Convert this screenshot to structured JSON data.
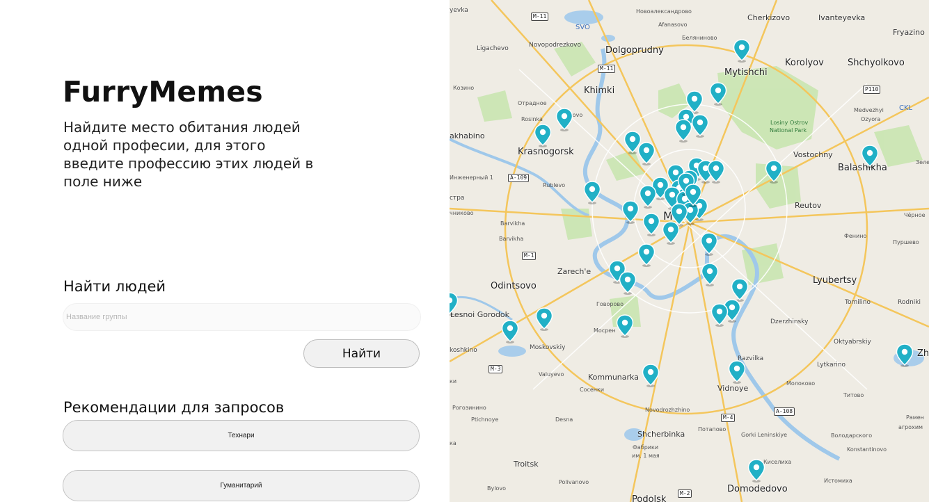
{
  "app": {
    "title": "FurryMemes",
    "description": "Найдите место обитания людей одной професии, для этого введите профессию этих людей в поле ниже"
  },
  "search": {
    "heading": "Найти людей",
    "placeholder": "Название группы",
    "value": "",
    "button_label": "Найти"
  },
  "recommendations": {
    "heading": "Рекомендации для запросов",
    "items": [
      "Технари",
      "Гуманитарий"
    ]
  },
  "map": {
    "labels": {
      "cherkizovo": "Cherkizovo",
      "ivanteyevka": "Ivanteyevka",
      "fryazino": "Fryazino",
      "novoaleksandrovo": "Новоалександрово",
      "afanasovo": "Afanasovo",
      "belyaninovo": "Беляниново",
      "lyevka": "yevka",
      "svo": "SVO",
      "ligachevo": "Ligachevo",
      "novopodrezkovo": "Novopodrezkovo",
      "dolgoprudny": "Dolgoprudny",
      "mytishchi": "Mytishchi",
      "korolyov": "Korolyov",
      "shchyolkovo": "Shchyolkovo",
      "kozino": "Козино",
      "khimki": "Khimki",
      "otradnoe": "Отрадное",
      "putilkovo": "Putilkovo",
      "rosinka": "Rosinka",
      "akhabino": "akhabino",
      "krasnogorsk": "Krasnogorsk",
      "medvezhyi": "Medvezhyi",
      "ozyora": "Ozyora",
      "ckl": "CKL",
      "losiny": "Losiny Ostrov",
      "national_park": "National Park",
      "vostochny": "Vostochny",
      "balashikha": "Balashikha",
      "zele": "Зеле",
      "inzhenerny": "Инженерный 1",
      "rublevo": "Rublevo",
      "reutov": "Reutov",
      "chernoe": "Чёрное",
      "ostra": "стра",
      "chnikovo": "чниково",
      "barvikha1": "Barvikha",
      "barvikha2": "Barvikha",
      "fenino": "Фенино",
      "purshevo": "Пуршево",
      "zarechye": "Zarech'e",
      "odintsovo": "Odintsovo",
      "lyubertsy": "Lyubertsy",
      "govorovo": "Говорово",
      "tomilino": "Tomilino",
      "rodniki": "Rodniki",
      "lesnoi": "Lesnoi Gorodok",
      "dzerzhinsky": "Dzerzhinsky",
      "mosrentgen": "Мосрен",
      "oktyabrsky": "Oktyabrskiy",
      "moskovskiy": "Moskovskiy",
      "koshkino": "koshkino",
      "razvilka": "Razvilka",
      "lytkarino": "Lytkarino",
      "zh": "Zh",
      "valuyevo": "Valuyevo",
      "kommunarka": "Kommunarka",
      "sosenki": "Сосенки",
      "vidnoye": "Vidnoye",
      "molokovo": "Молоково",
      "titovo": "Титово",
      "ki": "ки",
      "rogozinino": "Рогозинино",
      "novodrozhzhino": "Novodrozhzhino",
      "ptichnoye": "Ptichnoye",
      "desna": "Desna",
      "ramen": "Рамен",
      "agrokhim": "агрохим",
      "potapovo": "Потапово",
      "gorki": "Gorki Leninskiye",
      "volodarskogo": "Володарского",
      "shcherbinka": "Shcherbinka",
      "konstantinovo": "Konstantinovo",
      "ka": "ка",
      "fabriki1": "Фабрики",
      "fabriki2": "им. 1 мая",
      "troitsk": "Troitsk",
      "kiselikha": "Киселиха",
      "polivanovo": "Polivanovo",
      "istomikha": "Истомиха",
      "bylovo": "Bylovo",
      "domodedovo": "Domodedovo",
      "podolsk": "Podolsk",
      "moscow": "Mo"
    },
    "shields": {
      "m11a": "M-11",
      "m11b": "M-11",
      "p110": "P110",
      "a109": "A-109",
      "m1": "M-1",
      "m3": "M-3",
      "m4": "M-4",
      "a108": "A-108",
      "m2": "M-2"
    },
    "marker_color": "#21b0c6",
    "marker_count": 47
  }
}
